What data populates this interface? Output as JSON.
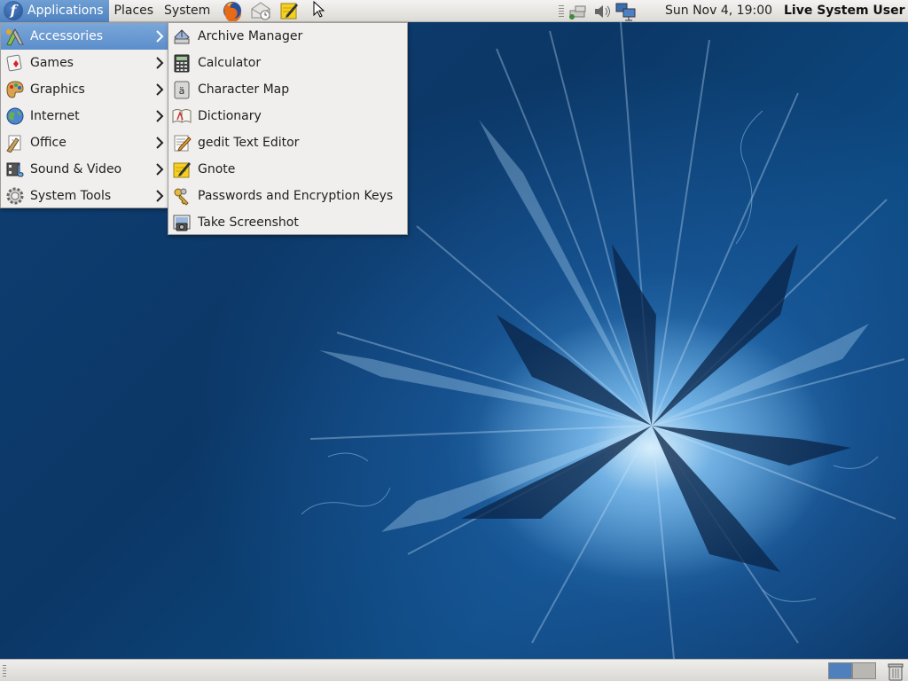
{
  "top_panel": {
    "menus": {
      "applications": "Applications",
      "places": "Places",
      "system": "System"
    },
    "launchers": [
      "firefox-icon",
      "evolution-mail-icon",
      "gnote-icon"
    ],
    "tray_icons": [
      "network-manager-icon",
      "volume-icon",
      "network-computer-icon"
    ],
    "clock": "Sun Nov  4, 19:00",
    "user": "Live System User"
  },
  "applications_menu": {
    "items": [
      {
        "label": "Accessories",
        "icon": "accessories-icon",
        "selected": true
      },
      {
        "label": "Games",
        "icon": "games-icon"
      },
      {
        "label": "Graphics",
        "icon": "graphics-icon"
      },
      {
        "label": "Internet",
        "icon": "internet-icon"
      },
      {
        "label": "Office",
        "icon": "office-icon"
      },
      {
        "label": "Sound & Video",
        "icon": "sound-video-icon"
      },
      {
        "label": "System Tools",
        "icon": "system-tools-icon"
      }
    ]
  },
  "accessories_submenu": {
    "items": [
      {
        "label": "Archive Manager",
        "icon": "archive-manager-icon"
      },
      {
        "label": "Calculator",
        "icon": "calculator-icon"
      },
      {
        "label": "Character Map",
        "icon": "character-map-icon"
      },
      {
        "label": "Dictionary",
        "icon": "dictionary-icon"
      },
      {
        "label": "gedit Text Editor",
        "icon": "text-editor-icon"
      },
      {
        "label": "Gnote",
        "icon": "gnote-icon"
      },
      {
        "label": "Passwords and Encryption Keys",
        "icon": "keys-icon"
      },
      {
        "label": "Take Screenshot",
        "icon": "screenshot-icon"
      }
    ]
  },
  "bottom_panel": {
    "workspaces": [
      "workspace-1",
      "workspace-2"
    ],
    "active_workspace": "workspace-1"
  },
  "colors": {
    "menu_selection": "#5b8ecb",
    "wallpaper": "#0e3a6a"
  }
}
